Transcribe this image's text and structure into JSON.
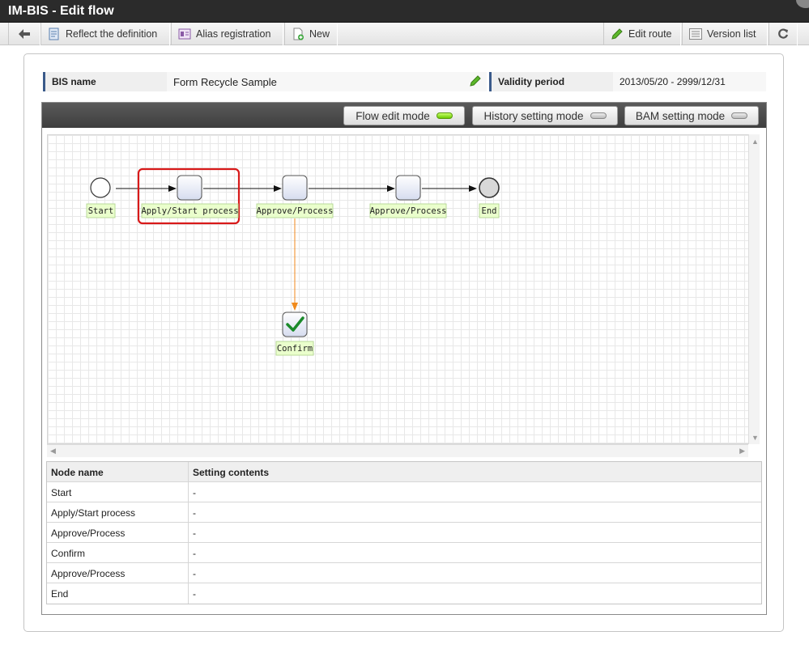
{
  "window": {
    "title": "IM-BIS - Edit flow"
  },
  "toolbar": {
    "reflect_label": "Reflect the definition",
    "alias_label": "Alias registration",
    "new_label": "New",
    "edit_route_label": "Edit route",
    "version_list_label": "Version list"
  },
  "info": {
    "bis_name_label": "BIS name",
    "bis_name_value": "Form Recycle Sample",
    "validity_label": "Validity period",
    "validity_value": "2013/05/20 - 2999/12/31"
  },
  "modes": {
    "flow_edit": "Flow edit mode",
    "history_setting": "History setting mode",
    "bam_setting": "BAM setting mode",
    "active": "Flow edit mode"
  },
  "flow": {
    "nodes": {
      "start": "Start",
      "apply": "Apply/Start process",
      "approve1": "Approve/Process",
      "approve2": "Approve/Process",
      "end": "End",
      "confirm": "Confirm"
    }
  },
  "table": {
    "headers": {
      "node_name": "Node name",
      "setting_contents": "Setting contents"
    },
    "rows": [
      {
        "node": "Start",
        "setting": "-"
      },
      {
        "node": "Apply/Start process",
        "setting": "-"
      },
      {
        "node": "Approve/Process",
        "setting": "-"
      },
      {
        "node": "Confirm",
        "setting": "-"
      },
      {
        "node": "Approve/Process",
        "setting": "-"
      },
      {
        "node": "End",
        "setting": "-"
      }
    ]
  },
  "colors": {
    "highlight": "#d81a1a",
    "label_bg": "#eaffcc",
    "branch_arrow": "#f08a1c",
    "active_led": "#6acb00"
  }
}
